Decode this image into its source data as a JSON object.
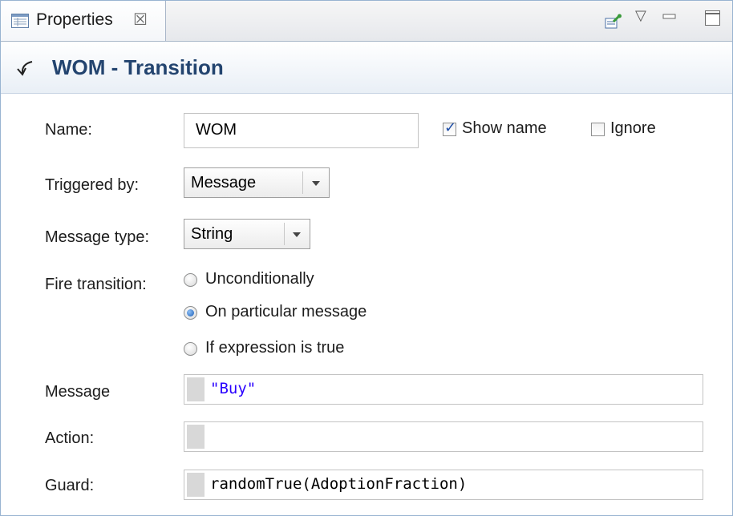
{
  "tab": {
    "label": "Properties",
    "close_glyph": "☒",
    "icon": "properties-icon"
  },
  "toolbar": {
    "icons": [
      "pin-to-view-icon",
      "view-menu-icon",
      "minimize-icon",
      "maximize-icon"
    ],
    "menu_glyph": "▽"
  },
  "title": {
    "icon": "transition-arrow-icon",
    "text": "WOM - Transition"
  },
  "form": {
    "name_label": "Name:",
    "name_value": "WOM",
    "show_name_label": "Show name",
    "show_name_checked": true,
    "ignore_label": "Ignore",
    "ignore_checked": false,
    "triggered_label": "Triggered by:",
    "triggered_value": "Message",
    "msgtype_label": "Message type:",
    "msgtype_value": "String",
    "fire_label": "Fire transition:",
    "fire_options": [
      "Unconditionally",
      "On particular message",
      "If expression is true"
    ],
    "fire_selected": 1,
    "message_label": "Message",
    "message_value": "\"Buy\"",
    "action_label": "Action:",
    "action_value": "",
    "guard_label": "Guard:",
    "guard_value": "randomTrue(AdoptionFraction)"
  },
  "colors": {
    "title_text": "#23446f",
    "string_literal": "#2a00ff",
    "radio_selected": "#1d5fb8",
    "border_accent": "#99b4d1"
  }
}
